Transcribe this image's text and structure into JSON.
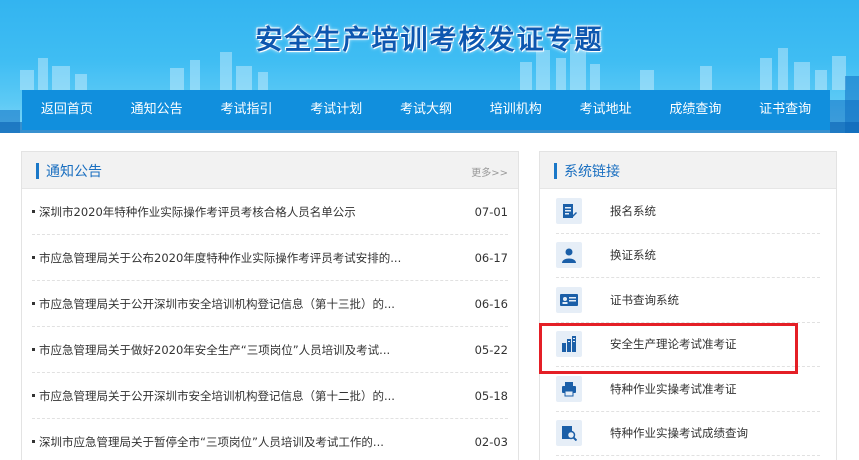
{
  "banner": {
    "title": "安全生产培训考核发证专题"
  },
  "nav": {
    "items": [
      "返回首页",
      "通知公告",
      "考试指引",
      "考试计划",
      "考试大纲",
      "培训机构",
      "考试地址",
      "成绩查询",
      "证书查询"
    ]
  },
  "notice": {
    "title": "通知公告",
    "more": "更多>>",
    "items": [
      {
        "text": "深圳市2020年特种作业实际操作考评员考核合格人员名单公示",
        "date": "07-01"
      },
      {
        "text": "市应急管理局关于公布2020年度特种作业实际操作考评员考试安排的...",
        "date": "06-17"
      },
      {
        "text": "市应急管理局关于公开深圳市安全培训机构登记信息（第十三批）的...",
        "date": "06-16"
      },
      {
        "text": "市应急管理局关于做好2020年安全生产“三项岗位”人员培训及考试...",
        "date": "05-22"
      },
      {
        "text": "市应急管理局关于公开深圳市安全培训机构登记信息（第十二批）的...",
        "date": "05-18"
      },
      {
        "text": "深圳市应急管理局关于暂停全市“三项岗位”人员培训及考试工作的...",
        "date": "02-03"
      }
    ]
  },
  "links": {
    "title": "系统链接",
    "items": [
      {
        "label": "报名系统",
        "icon": "signup-form-icon"
      },
      {
        "label": "换证系统",
        "icon": "user-icon"
      },
      {
        "label": "证书查询系统",
        "icon": "id-card-icon"
      },
      {
        "label": "安全生产理论考试准考证",
        "icon": "building-icon"
      },
      {
        "label": "特种作业实操考试准考证",
        "icon": "printer-icon"
      },
      {
        "label": "特种作业实操考试成绩查询",
        "icon": "search-document-icon"
      }
    ]
  },
  "colors": {
    "accent": "#1a78c8",
    "nav_bg": "#118fdd",
    "highlight": "#e41f26",
    "icon_fg": "#1b5fa8"
  }
}
